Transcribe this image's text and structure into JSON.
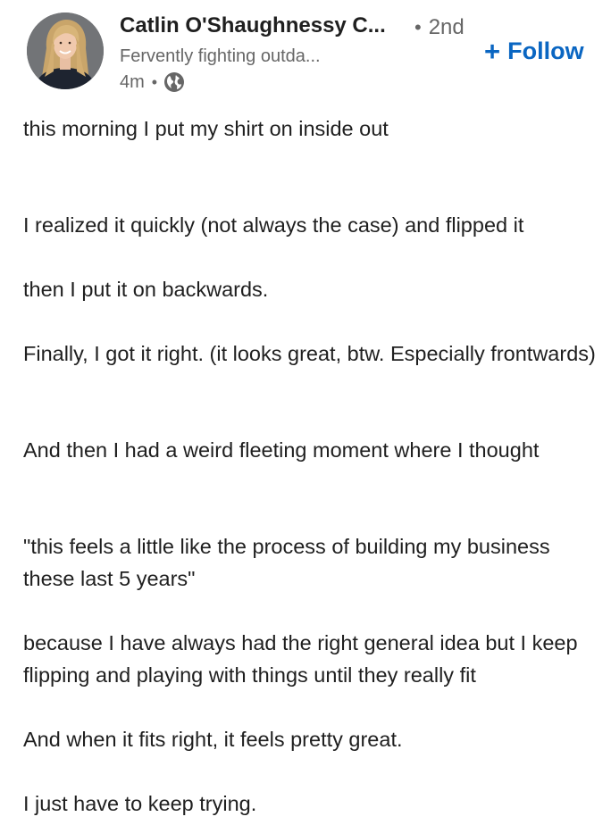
{
  "author": {
    "name": "Catlin O'Shaughnessy C...",
    "degree": "2nd",
    "headline": "Fervently fighting outda...",
    "time": "4m",
    "visibility_icon": "globe-icon",
    "avatar_icon": "profile-photo"
  },
  "follow": {
    "label": "Follow",
    "icon": "plus-icon",
    "color": "#0a66c2"
  },
  "post": {
    "paragraphs": [
      "this morning I put my shirt on inside out",
      "I realized it quickly (not always the case) and flipped it",
      "then I put it on backwards.",
      "Finally, I got it right. (it looks great, btw. Especially frontwards)",
      "And then I had a weird fleeting moment where I thought",
      "\"this feels a little like the process of building my business these last 5 years\"",
      "because I have always had the right general idea but I keep flipping and playing with things until they really fit",
      "And when it fits right, it feels pretty great.",
      "I just have to keep trying."
    ]
  }
}
